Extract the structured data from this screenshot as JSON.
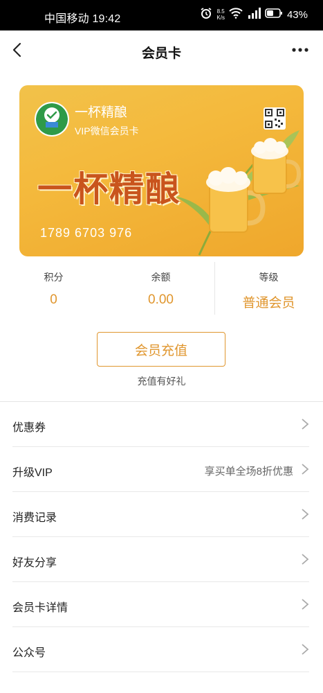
{
  "status_bar": {
    "carrier_time": "中国移动 19:42",
    "speed_value": "8.5",
    "speed_unit": "K/s",
    "battery": "43%"
  },
  "nav": {
    "title": "会员卡"
  },
  "card": {
    "brand_name": "一杯精酿",
    "subtitle": "VIP微信会员卡",
    "big_title": "一杯精酿",
    "card_number": "1789 6703 976",
    "colors": {
      "gradient_start": "#f2c24a",
      "gradient_end": "#efa72c",
      "title": "#c9541d"
    }
  },
  "stats": [
    {
      "label": "积分",
      "value": "0"
    },
    {
      "label": "余额",
      "value": "0.00"
    },
    {
      "label": "等级",
      "value": "普通会员"
    }
  ],
  "recharge": {
    "button_label": "会员充值",
    "hint": "充值有好礼",
    "accent_color": "#e0962e"
  },
  "menu": [
    {
      "label": "优惠券",
      "extra": ""
    },
    {
      "label": "升级VIP",
      "extra": "享买单全场8折优惠"
    },
    {
      "label": "消费记录",
      "extra": ""
    },
    {
      "label": "好友分享",
      "extra": ""
    },
    {
      "label": "会员卡详情",
      "extra": ""
    },
    {
      "label": "公众号",
      "extra": ""
    }
  ]
}
